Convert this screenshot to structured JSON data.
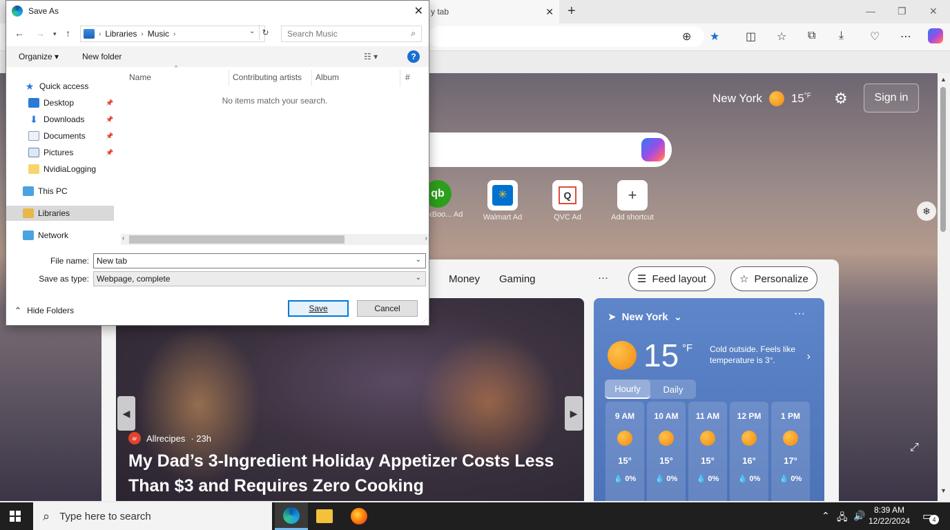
{
  "browser": {
    "tab_title": "New tab",
    "tab_title_visible": "y tab"
  },
  "newtab": {
    "weather_city": "New York",
    "weather_temp": "15",
    "weather_unit": "°F",
    "sign_in": "Sign in",
    "shortcuts": [
      {
        "name": "QuickBoo...",
        "ad": "Ad",
        "icon": "qb"
      },
      {
        "name": "Walmart",
        "ad": "Ad",
        "icon": "walmart"
      },
      {
        "name": "QVC",
        "ad": "Ad",
        "icon": "qvc"
      },
      {
        "name": "Add shortcut",
        "ad": "",
        "icon": "+"
      }
    ],
    "nav": [
      "Money",
      "Gaming"
    ],
    "more": "···",
    "feed_layout": "Feed layout",
    "personalize": "Personalize",
    "hero": {
      "source": "Allrecipes",
      "source_logo": "ar",
      "age": "· 23h",
      "headline": "My Dad’s 3-Ingredient Holiday Appetizer Costs Less Than $3 and Requires Zero Cooking"
    },
    "weather_card": {
      "city": "New York",
      "temp": "15",
      "unit": "°F",
      "desc": "Cold outside. Feels like temperature is 3°.",
      "tabs": [
        "Hourly",
        "Daily"
      ],
      "hours": [
        {
          "time": "9 AM",
          "temp": "15°",
          "precip": "0%"
        },
        {
          "time": "10 AM",
          "temp": "15°",
          "precip": "0%"
        },
        {
          "time": "11 AM",
          "temp": "15°",
          "precip": "0%"
        },
        {
          "time": "12 PM",
          "temp": "16°",
          "precip": "0%"
        },
        {
          "time": "1 PM",
          "temp": "17°",
          "precip": "0%"
        }
      ]
    }
  },
  "dialog": {
    "title": "Save As",
    "path": [
      "Libraries",
      "Music"
    ],
    "search_placeholder": "Search Music",
    "organize": "Organize",
    "new_folder": "New folder",
    "nav_items": [
      {
        "label": "Quick access",
        "icon": "star"
      },
      {
        "label": "Desktop",
        "icon": "desktop",
        "pinned": true
      },
      {
        "label": "Downloads",
        "icon": "download",
        "pinned": true
      },
      {
        "label": "Documents",
        "icon": "document",
        "pinned": true
      },
      {
        "label": "Pictures",
        "icon": "pictures",
        "pinned": true
      },
      {
        "label": "NvidiaLogging",
        "icon": "folder"
      },
      {
        "label": "This PC",
        "icon": "pc"
      },
      {
        "label": "Libraries",
        "icon": "library",
        "selected": true
      },
      {
        "label": "Network",
        "icon": "network"
      }
    ],
    "columns": [
      "Name",
      "Contributing artists",
      "Album",
      "#"
    ],
    "empty_message": "No items match your search.",
    "file_name_label": "File name:",
    "file_name_value": "New tab",
    "save_type_label": "Save as type:",
    "save_type_value": "Webpage, complete",
    "hide_folders": "Hide Folders",
    "save": "Save",
    "cancel": "Cancel"
  },
  "taskbar": {
    "search_placeholder": "Type here to search",
    "time": "8:39 AM",
    "date": "12/22/2024",
    "notifications": "4"
  }
}
